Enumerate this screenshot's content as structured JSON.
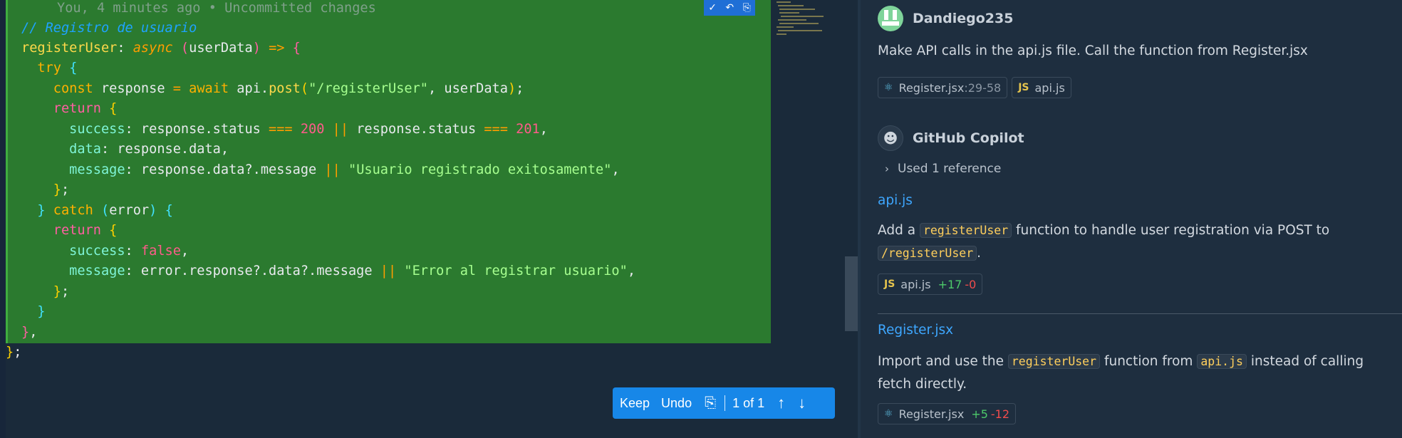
{
  "editor": {
    "blame": "You, 4 minutes ago • Uncommitted changes",
    "inline_actions": [
      "✓",
      "↶",
      "⎘"
    ]
  },
  "review_bar": {
    "keep": "Keep",
    "undo": "Undo",
    "counter": "1 of 1"
  },
  "chat": {
    "user": {
      "name": "Dandiego235",
      "message": "Make API calls in the api.js file. Call the function from Register.jsx",
      "refs": [
        {
          "icon": "react-file-icon",
          "name": "Register.jsx",
          "range": ":29-58"
        },
        {
          "icon": "js-file-icon",
          "name": "api.js",
          "range": ""
        }
      ]
    },
    "assistant": {
      "name": "GitHub Copilot",
      "used_refs": "Used 1 reference",
      "sections": [
        {
          "file": "api.js",
          "text_before": "Add a",
          "code1": "registerUser",
          "text_mid": "function to handle user registration via POST to",
          "code2": "/registerUser",
          "text_after": ".",
          "chip": {
            "name": "api.js",
            "added": "+17",
            "removed": "-0"
          }
        },
        {
          "file": "Register.jsx",
          "text_before": "Import and use the",
          "code1": "registerUser",
          "text_mid": "function from",
          "code2": "api.js",
          "text_after": "instead of calling fetch directly.",
          "chip": {
            "name": "Register.jsx",
            "added": "+5",
            "removed": "-12"
          }
        }
      ]
    }
  }
}
